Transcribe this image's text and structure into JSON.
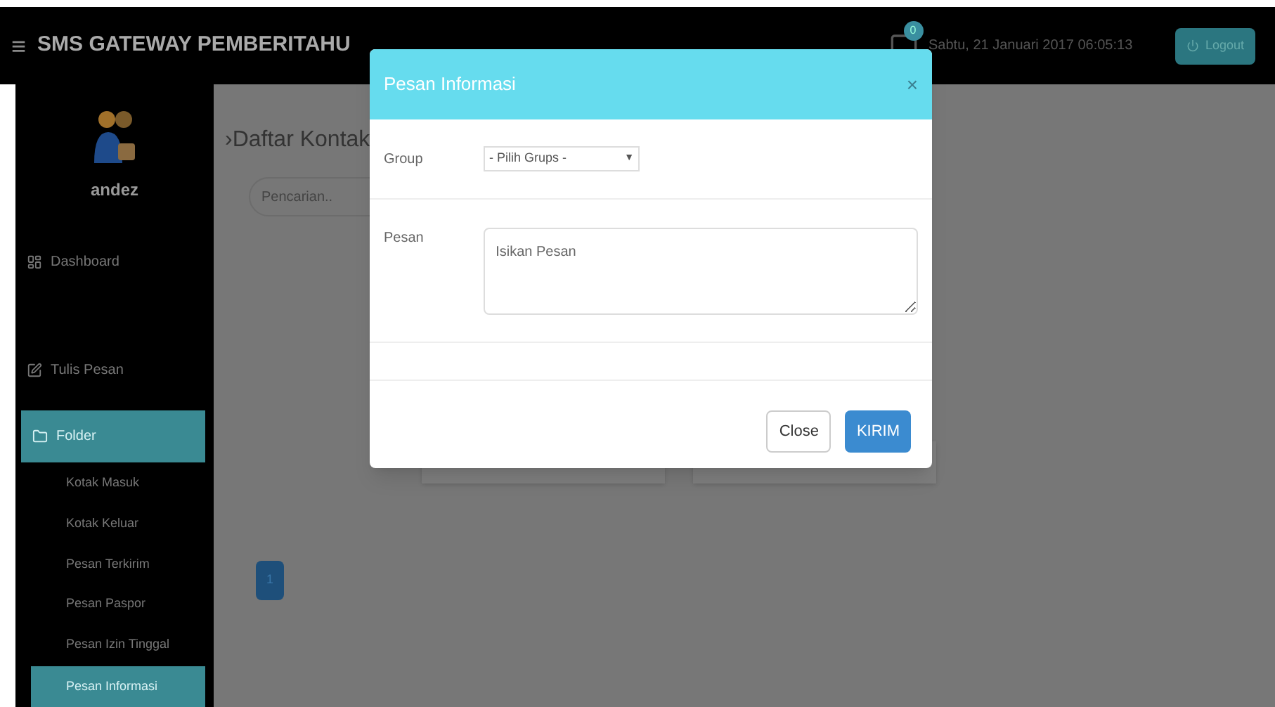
{
  "header": {
    "menu_icon": "≡",
    "title": "SMS GATEWAY PEMBERITAHU",
    "notification_count": "0",
    "datetime": "Sabtu, 21 Januari 2017 06:05:13",
    "logout": "Logout"
  },
  "sidebar": {
    "user": "andez",
    "items": [
      {
        "label": "Dashboard",
        "kind": "main",
        "selected": false
      },
      {
        "label": "Tulis Pesan",
        "kind": "main",
        "selected": false
      },
      {
        "label": "Folder",
        "kind": "main",
        "selected": true
      },
      {
        "label": "Kotak Masuk",
        "kind": "sub",
        "selected": false
      },
      {
        "label": "Kotak Keluar",
        "kind": "sub",
        "selected": false
      },
      {
        "label": "Pesan Terkirim",
        "kind": "sub",
        "selected": false
      },
      {
        "label": "Pesan Paspor",
        "kind": "sub",
        "selected": false
      },
      {
        "label": "Pesan Izin Tinggal",
        "kind": "sub",
        "selected": false
      },
      {
        "label": "Pesan Informasi",
        "kind": "sub",
        "selected": true
      }
    ]
  },
  "content": {
    "title": "›Daftar Kontak",
    "search_placeholder": "Pencarian..",
    "pages": [
      {
        "label": "1",
        "selected": true
      }
    ]
  },
  "modal": {
    "title": "Pesan Informasi",
    "close_icon": "×",
    "group_label": "Group",
    "group_value": "- Pilih Grups -",
    "group_caret": "▼",
    "message_label": "Pesan",
    "message_placeholder": "Isikan Pesan",
    "buttons": [
      {
        "label": "Close",
        "kind": "default"
      },
      {
        "label": "KIRIM",
        "kind": "primary"
      }
    ]
  }
}
